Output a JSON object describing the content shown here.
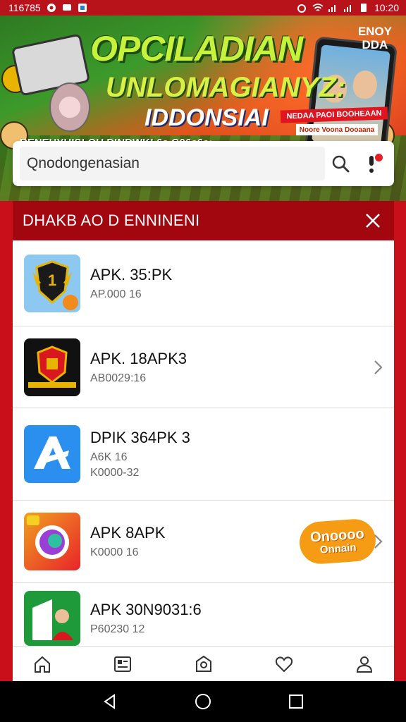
{
  "status_bar": {
    "left_text": "116785",
    "time": "10:20"
  },
  "banner": {
    "title": "OPCILADIAN",
    "subtitle": "UNLOMAGIANYZ:",
    "subtitle2": "IDDONSIAI",
    "caption": "RENEHYHIS! OU DINDWK! 6a G06e6e:",
    "brand_line1": "ENOY",
    "brand_line2": "DDA",
    "phone_badge": "NEDAA PAOI BOOHEAAN",
    "phone_badge2": "Noore Voona Dooaana"
  },
  "search": {
    "value": "Qnodongenasian"
  },
  "panel": {
    "title": "DHAKB AO D ENNINENI"
  },
  "items": [
    {
      "name": "APK. 35:PK",
      "sub1": "AP.000 16",
      "sub2": ""
    },
    {
      "name": "APK. 18APK3",
      "sub1": "AB0029:16",
      "sub2": ""
    },
    {
      "name": "DPIK 364PK 3",
      "sub1": "A6K 16",
      "sub2": "K0000-32"
    },
    {
      "name": "APK 8APK",
      "sub1": "K0000 16",
      "sub2": ""
    },
    {
      "name": "APK 30N9031:6",
      "sub1": "P60230 12",
      "sub2": ""
    }
  ],
  "promo": {
    "line1": "Onoooo",
    "line2": "Onnain"
  },
  "colors": {
    "accent_red": "#c9101a",
    "header_red": "#a2060f",
    "promo_orange": "#f59b14"
  },
  "icons": [
    "home-icon",
    "news-icon",
    "apps-icon",
    "heart-icon",
    "profile-icon",
    "search-icon",
    "mic-icon",
    "close-icon",
    "chevron-right-icon"
  ]
}
